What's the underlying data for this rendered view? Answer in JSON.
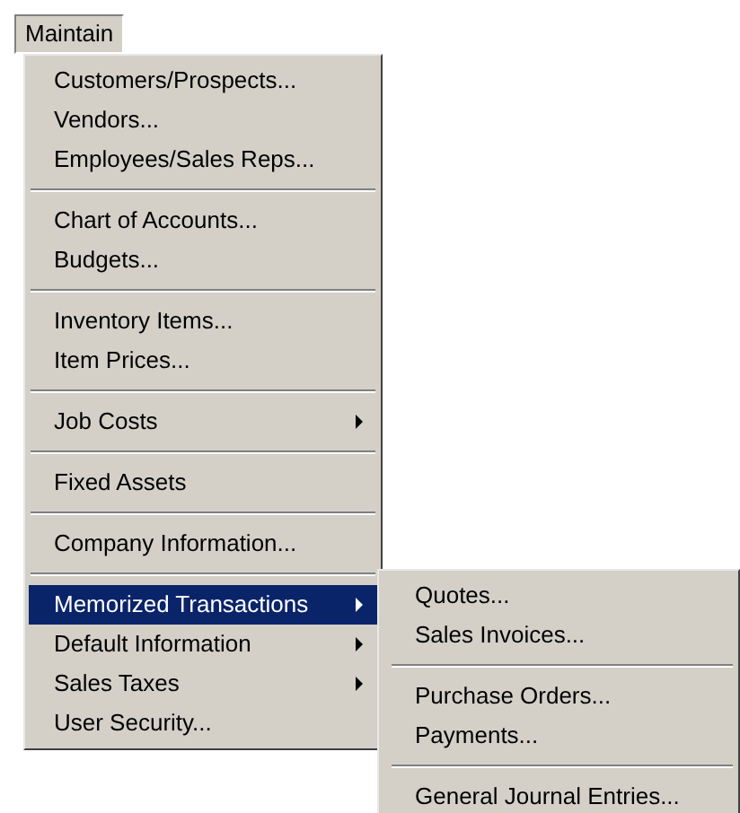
{
  "menu_bar": {
    "title": "Maintain",
    "selected": true
  },
  "menu": {
    "groups": [
      [
        {
          "label": "Customers/Prospects...",
          "has_submenu": false,
          "selected": false
        },
        {
          "label": "Vendors...",
          "has_submenu": false,
          "selected": false
        },
        {
          "label": "Employees/Sales Reps...",
          "has_submenu": false,
          "selected": false
        }
      ],
      [
        {
          "label": "Chart of Accounts...",
          "has_submenu": false,
          "selected": false
        },
        {
          "label": "Budgets...",
          "has_submenu": false,
          "selected": false
        }
      ],
      [
        {
          "label": "Inventory Items...",
          "has_submenu": false,
          "selected": false
        },
        {
          "label": "Item Prices...",
          "has_submenu": false,
          "selected": false
        }
      ],
      [
        {
          "label": "Job Costs",
          "has_submenu": true,
          "selected": false
        }
      ],
      [
        {
          "label": "Fixed Assets",
          "has_submenu": false,
          "selected": false
        }
      ],
      [
        {
          "label": "Company Information...",
          "has_submenu": false,
          "selected": false
        }
      ],
      [
        {
          "label": "Memorized Transactions",
          "has_submenu": true,
          "selected": true
        },
        {
          "label": "Default Information",
          "has_submenu": true,
          "selected": false
        },
        {
          "label": "Sales Taxes",
          "has_submenu": true,
          "selected": false
        },
        {
          "label": "User Security...",
          "has_submenu": false,
          "selected": false
        }
      ]
    ]
  },
  "submenu": {
    "groups": [
      [
        {
          "label": "Quotes...",
          "has_submenu": false,
          "selected": false
        },
        {
          "label": "Sales Invoices...",
          "has_submenu": false,
          "selected": false
        }
      ],
      [
        {
          "label": "Purchase Orders...",
          "has_submenu": false,
          "selected": false
        },
        {
          "label": "Payments...",
          "has_submenu": false,
          "selected": false
        }
      ],
      [
        {
          "label": "General Journal Entries...",
          "has_submenu": false,
          "selected": false
        }
      ]
    ]
  }
}
